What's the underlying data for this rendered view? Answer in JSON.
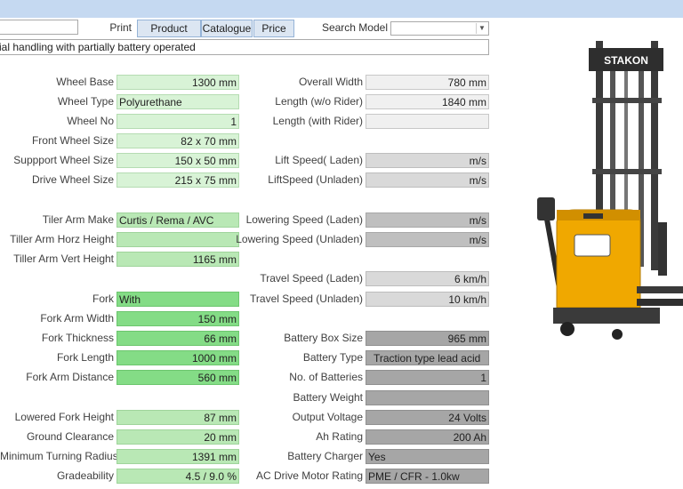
{
  "toolbar": {
    "print_label": "Print",
    "tabs": [
      "Product",
      "Catalogue",
      "Price"
    ],
    "search_label": "Search Model",
    "search_value": ""
  },
  "description": "ial handling with partially battery operated",
  "brand": "STAKON",
  "left": [
    {
      "label": "Wheel Base",
      "value": "1300 mm"
    },
    {
      "label": "Wheel Type",
      "value": "Polyurethane"
    },
    {
      "label": "Wheel No",
      "value": "1"
    },
    {
      "label": "Front Wheel Size",
      "value": "82 x 70 mm"
    },
    {
      "label": "Suppport Wheel Size",
      "value": "150 x 50 mm"
    },
    {
      "label": "Drive Wheel Size",
      "value": "215 x 75 mm"
    },
    {
      "label": "Tiler Arm Make",
      "value": "Curtis / Rema / AVC"
    },
    {
      "label": "Tiller Arm Horz Height",
      "value": ""
    },
    {
      "label": "Tiller Arm Vert Height",
      "value": "1165 mm"
    },
    {
      "label": "Fork",
      "value": "With"
    },
    {
      "label": "Fork Arm Width",
      "value": "150 mm"
    },
    {
      "label": "Fork Thickness",
      "value": "66 mm"
    },
    {
      "label": "Fork Length",
      "value": "1000 mm"
    },
    {
      "label": "Fork Arm Distance",
      "value": "560 mm"
    },
    {
      "label": "Lowered Fork Height",
      "value": "87 mm"
    },
    {
      "label": "Ground Clearance",
      "value": "20 mm"
    },
    {
      "label": "Minimum Turning Radius",
      "value": "1391 mm"
    },
    {
      "label": "Gradeability",
      "value": "4.5 / 9.0 %"
    }
  ],
  "right": [
    {
      "label": "Overall Width",
      "value": "780 mm"
    },
    {
      "label": "Length (w/o Rider)",
      "value": "1840 mm"
    },
    {
      "label": "Length (with Rider)",
      "value": ""
    },
    {
      "label": "Lift Speed( Laden)",
      "value": "m/s"
    },
    {
      "label": "LiftSpeed (Unladen)",
      "value": "m/s"
    },
    {
      "label": "Lowering Speed (Laden)",
      "value": "m/s"
    },
    {
      "label": "Lowering Speed (Unladen)",
      "value": "m/s"
    },
    {
      "label": "Travel Speed (Laden)",
      "value": "6 km/h"
    },
    {
      "label": "Travel Speed (Unladen)",
      "value": "10 km/h"
    },
    {
      "label": "Battery Box Size",
      "value": "965 mm"
    },
    {
      "label": "Battery Type",
      "value": "Traction type lead acid"
    },
    {
      "label": "No. of Batteries",
      "value": "1"
    },
    {
      "label": "Battery Weight",
      "value": ""
    },
    {
      "label": "Output Voltage",
      "value": "24 Volts"
    },
    {
      "label": "Ah Rating",
      "value": "200 Ah"
    },
    {
      "label": "Battery Charger",
      "value": "Yes"
    },
    {
      "label": "AC Drive Motor Rating",
      "value": "PME / CFR - 1.0kw"
    }
  ]
}
